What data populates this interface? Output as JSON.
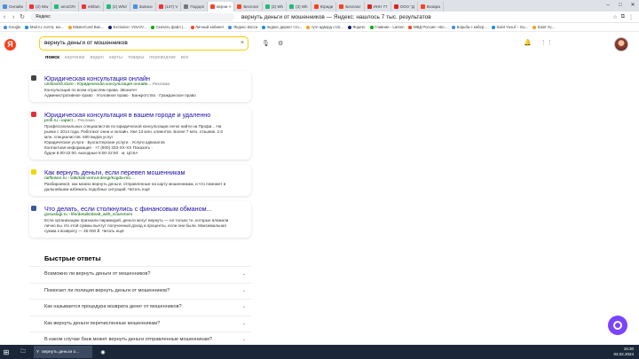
{
  "browser": {
    "tabs": [
      {
        "label": "Онлайн",
        "color": "#4a90d9",
        "active": false
      },
      {
        "label": "(2) Ww",
        "color": "#e33",
        "active": false
      },
      {
        "label": "amoCRI",
        "color": "#2b7",
        "active": false
      },
      {
        "label": "rekfam",
        "color": "#e33",
        "active": false
      },
      {
        "label": "(2) Whd",
        "color": "#2b7",
        "active": false
      },
      {
        "label": "Записи",
        "color": "#4a90d9",
        "active": false
      },
      {
        "label": "(137) V",
        "color": "#e33",
        "active": false
      },
      {
        "label": "Подорп",
        "color": "#777",
        "active": false
      },
      {
        "label": "верни ×",
        "color": "#fc3f1d",
        "active": true
      },
      {
        "label": "Бесплат",
        "color": "#fc3f1d",
        "active": false
      },
      {
        "label": "(3) Wh",
        "color": "#2b7",
        "active": false
      },
      {
        "label": "(3) Wh",
        "color": "#2b7",
        "active": false
      },
      {
        "label": "Юриди",
        "color": "#fc3f1d",
        "active": false
      },
      {
        "label": "Бесплат",
        "color": "#fc3f1d",
        "active": false
      },
      {
        "label": "ИНН 77",
        "color": "#d22",
        "active": false
      },
      {
        "label": "ООО \"Д",
        "color": "#d22",
        "active": false
      },
      {
        "label": "Возвра",
        "color": "#fc3f1d",
        "active": false
      }
    ],
    "address": "Яндекс",
    "page_title": "вернуть деньги от мошенников — Яндекс: нашлось 7 тыс. результатов",
    "bookmarks": [
      "Google",
      "Mail.ru: почта, мо...",
      "MasterCard Ban...",
      "Exclusive: VISA/V...",
      "Скачать файл |...",
      "Личный кабинет",
      "Яндекс.Касса",
      "яндекс директ сто...",
      "гугл адворд стат...",
      "Яндекс",
      "Главная - Larsen",
      "МВД России: «Бо...",
      "Борьба с кибер...",
      "Saint Yusuf – Gu...",
      "Saint Yu..."
    ]
  },
  "header": {
    "logo": "Я",
    "query": "вернуть деньги от мошенников",
    "clear_icon": "×"
  },
  "navtabs": [
    "поиск",
    "картинки",
    "видео",
    "карты",
    "товары",
    "переводчик",
    "все"
  ],
  "results": [
    {
      "favicon_color": "#444",
      "title": "Юридическая консультация онлайн",
      "url": "uristovet3.store › Юридическая консультация онлайн...",
      "ad": "Реклама",
      "text": [
        "Консультация по всем отраслям права. Звоните!"
      ],
      "links": "Административное право · Уголовное право · Банкротство · Гражданское право"
    },
    {
      "favicon_color": "#e0303a",
      "title": "Юридическая консультация в вашем городе и удаленно",
      "url": "profi.ru › юрист... ",
      "ad": "Реклама",
      "text": [
        "Профессиональных специалистов по юридической консультации легко найти на Профи... На",
        "рынке с 2014 года. Работают онни и онлайн. Уже 13 млн. клиентов. Более 7 млн. отзывов. 2.6",
        "млн. специалистов. 500 видов услуг"
      ],
      "links": "Юридические услуги · Бухгалтерские услуги · Услуги адвокатов\nКонтактная информация · +7 (800) 333-XX-XX Показать ·\nбудни 6:00-22:00, выходные 6:00-22:00 · м. ЦСКА"
    },
    {
      "favicon_color": "#f2d600",
      "title": "Как вернуть деньги, если перевел мошенникам",
      "url": "raiffeisen.ru › wiki/kak-vernut-dengi/kogda-mo...",
      "ad": "",
      "text": [
        "Разбираемся, как можно вернуть деньги, отправленные на карту мошенникам, и что поможет в",
        "дальнейшем избежать подобных ситуаций. Читать ещё"
      ],
      "links": ""
    },
    {
      "favicon_color": "#3b5998",
      "title": "Что делать, если столкнулись с финансовым обманом...",
      "url": "gosuslugi.ru › life/details/dealt_with_scammers",
      "ad": "",
      "text": [
        "Если организацию признали пирамидой, деньги могут вернуть — но только те, которые вложили",
        "лично вы. Из этой суммы вычтут полученный доход и проценты, если они были. Максимальная",
        "сумма к возврату — 35 000 ₽. Читать ещё"
      ],
      "links": ""
    }
  ],
  "quick_answers": {
    "heading": "Быстрые ответы",
    "items": [
      "Возможно ли вернуть деньги от мошенников?",
      "Помогает ли полиция вернуть деньги от мошенников?",
      "Как называется процедура возврата денег от мошенников?",
      "Как вернуть деньги перечисленные мошенникам?",
      "В каком случае банк может вернуть деньги отправленные мошенникам?"
    ]
  },
  "taskbar": {
    "yandex_app": "вернуть деньги о...",
    "time": "15:30",
    "date": "03.02.2024"
  }
}
